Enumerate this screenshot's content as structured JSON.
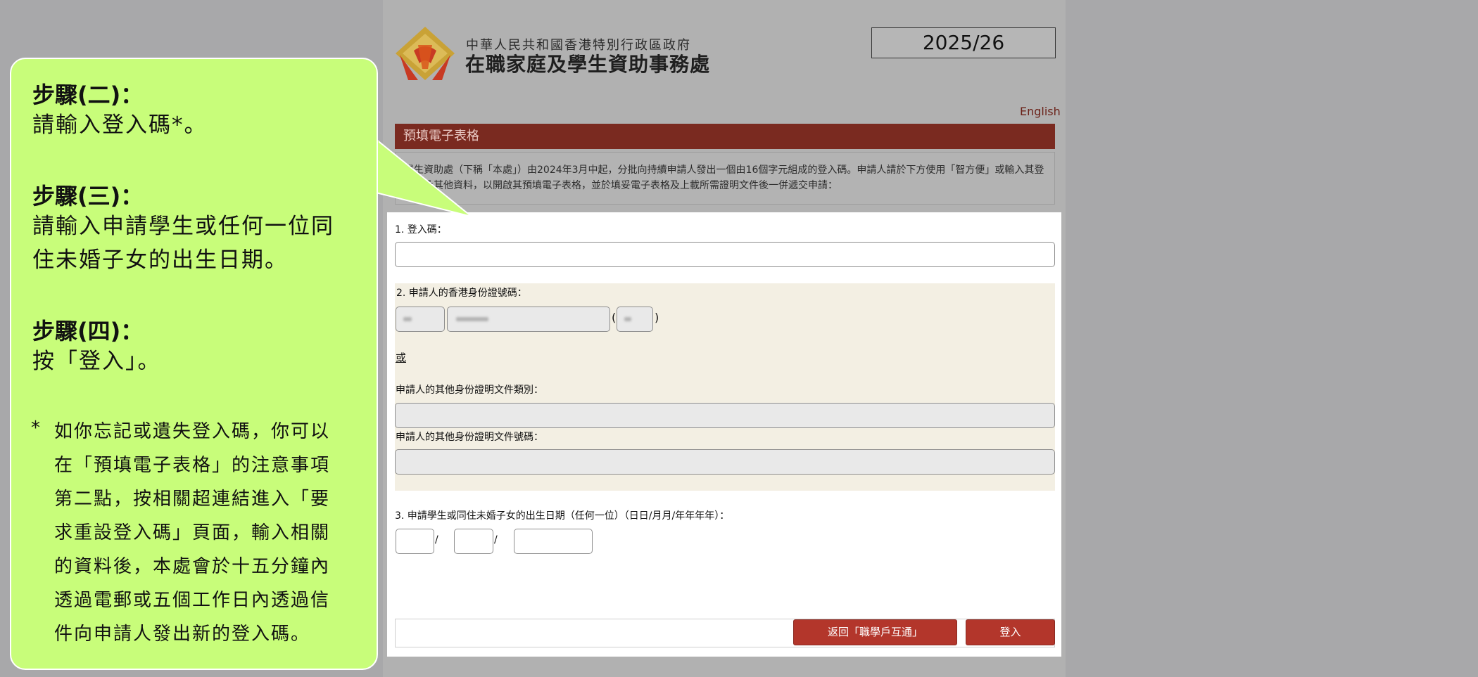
{
  "header": {
    "gov_name": "中華人民共和國香港特別行政區政府",
    "office_name": "在職家庭及學生資助事務處",
    "year": "2025/26",
    "lang_link": "English"
  },
  "section": {
    "title": "預填電子表格",
    "intro": "學生資助處（下稱「本處」）由2024年3月中起，分批向持續申請人發出一個由16個字元組成的登入碼。申請人請於下方使用「智方便」或輸入其登入碼及其他資料，以開啟其預填電子表格，並於填妥電子表格及上載所需證明文件後一併遞交申請："
  },
  "form": {
    "field1_label": "1. 登入碼：",
    "field1_value": "",
    "field2_label": "2. 申請人的香港身份證號碼：",
    "paren_open": "(",
    "paren_close": ")",
    "or_text": "或",
    "other_type_label": "申請人的其他身份證明文件類別：",
    "other_type_value": "",
    "other_no_label": "申請人的其他身份證明文件號碼：",
    "other_no_value": "",
    "field3_label": "3. 申請學生或同住未婚子女的出生日期（任何一位）（日日/月月/年年年年）：",
    "date_sep": "/"
  },
  "buttons": {
    "back": "返回「職學戶互通」",
    "login": "登入"
  },
  "callout": {
    "step2_title": "步驟(二)：",
    "step2_text": "請輸入登入碼*。",
    "step3_title": "步驟(三)：",
    "step3_text": "請輸入申請學生或任何一位同住未婚子女的出生日期。",
    "step4_title": "步驟(四)：",
    "step4_text": "按「登入」。",
    "note_marker": "*",
    "note_text": "如你忘記或遺失登入碼，你可以在「預填電子表格」的注意事項第二點，按相關超連結進入「要求重設登入碼」頁面，輸入相關的資料後，本處會於十五分鐘內透過電郵或五個工作日內透過信件向申請人發出新的登入碼。"
  },
  "colors": {
    "section_bar": "#7a2a20",
    "button": "#b3362b",
    "callout": "#c8fd7a",
    "id_zone": "#f3efe3"
  }
}
